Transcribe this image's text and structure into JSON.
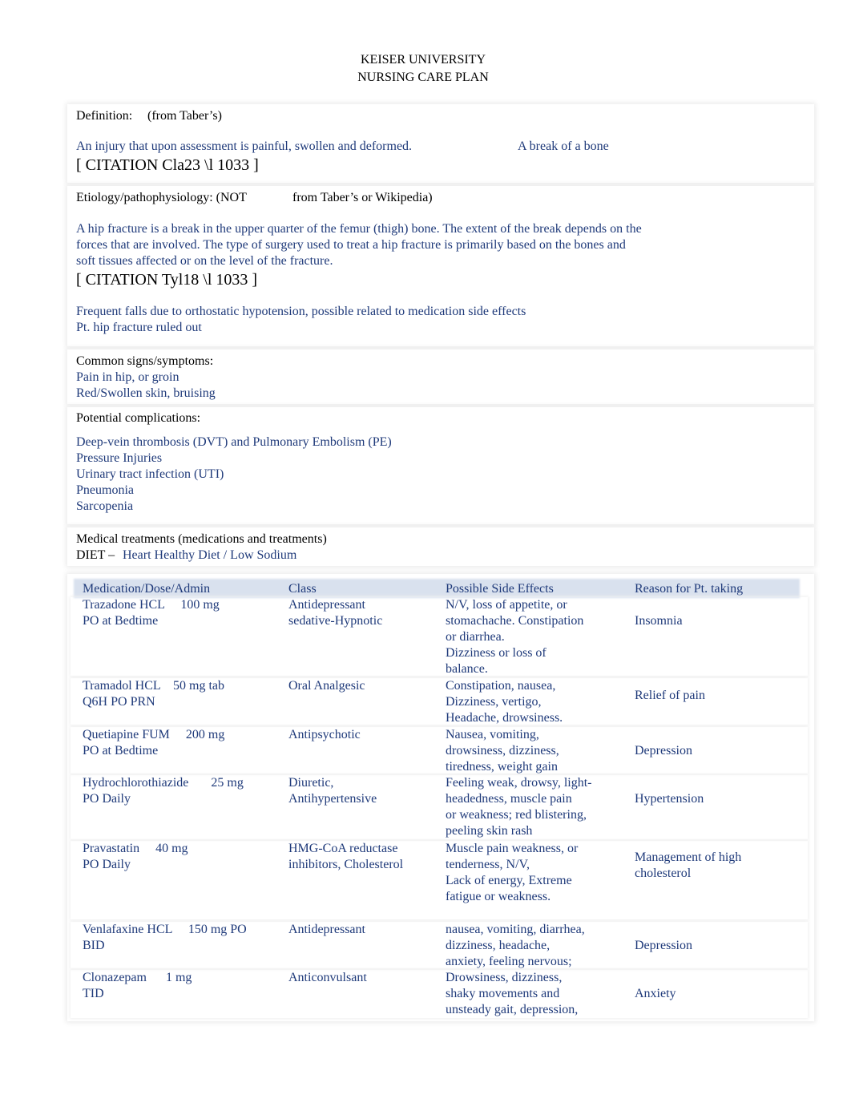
{
  "title": [
    "KEISER UNIVERSITY",
    "NURSING CARE PLAN"
  ],
  "definition": {
    "label": "Definition:",
    "source": "(from Taber’s)",
    "text": "An injury that upon assessment is painful, swollen and deformed.",
    "text2": "A break of a bone",
    "citation": "[ CITATION Cla23 \\l 1033 ]"
  },
  "etiology": {
    "label": "Etiology/pathophysiology: (NOT",
    "label2": "from Taber’s or Wikipedia)",
    "lines": [
      "A hip fracture is a break in the upper quarter of the femur (thigh) bone. The extent of the break depends on the",
      "forces that are involved. The type of surgery used to treat a hip fracture is primarily based on the bones and",
      "soft tissues affected or on the level of the fracture."
    ],
    "citation": "[ CITATION Tyl18 \\l 1033 ]",
    "notes": [
      "Frequent falls due to orthostatic hypotension, possible related to medication side effects",
      "Pt. hip fracture ruled out"
    ]
  },
  "signs": {
    "label": "Common signs/symptoms:",
    "items": [
      "Pain in hip, or groin",
      "Red/Swollen skin, bruising"
    ]
  },
  "complications": {
    "label": "Potential complications:",
    "items": [
      "Deep-vein thrombosis (DVT) and Pulmonary Embolism (PE)",
      "Pressure Injuries",
      "Urinary tract infection (UTI)",
      "Pneumonia",
      "Sarcopenia"
    ]
  },
  "treatments": {
    "label": "Medical treatments (medications and treatments)",
    "diet_label": "DIET – ",
    "diet": "Heart Healthy Diet / Low Sodium"
  },
  "table": {
    "headers": [
      "Medication/Dose/Admin",
      "Class",
      "Possible Side Effects",
      "Reason for Pt. taking"
    ],
    "rows": [
      {
        "med": [
          "Trazadone HCL     100 mg",
          "PO at Bedtime"
        ],
        "cls": [
          "Antidepressant",
          "sedative-Hypnotic"
        ],
        "fx": [
          "N/V, loss of appetite, or",
          "stomachache. Constipation",
          "or diarrhea.",
          "Dizziness or loss of",
          "balance."
        ],
        "reason": "Insomnia"
      },
      {
        "med": [
          "Tramadol HCL    50 mg tab",
          "Q6H PO PRN"
        ],
        "cls": [
          "Oral Analgesic"
        ],
        "fx": [
          "Constipation, nausea,",
          "Dizziness, vertigo,",
          "Headache, drowsiness."
        ],
        "reason": "Relief of pain"
      },
      {
        "med": [
          "Quetiapine FUM     200 mg",
          "PO at Bedtime"
        ],
        "cls": [
          "Antipsychotic"
        ],
        "fx": [
          "Nausea, vomiting,",
          "drowsiness, dizziness,",
          "tiredness, weight gain"
        ],
        "reason": "Depression"
      },
      {
        "med": [
          "Hydrochlorothiazide       25 mg",
          "PO Daily"
        ],
        "cls": [
          "Diuretic,",
          "Antihypertensive"
        ],
        "fx": [
          "Feeling weak, drowsy, light-",
          "headedness, muscle pain",
          "or weakness; red blistering,",
          "peeling skin rash"
        ],
        "reason": "Hypertension"
      },
      {
        "med": [
          "Pravastatin     40 mg",
          "PO Daily"
        ],
        "cls": [
          "HMG-CoA reductase",
          "inhibitors, Cholesterol"
        ],
        "fx": [
          "Muscle pain weakness, or",
          "tenderness, N/V,",
          "Lack of energy, Extreme",
          "fatigue or weakness."
        ],
        "reason": "Management of high\ncholesterol"
      },
      {
        "med": [
          "Venlafaxine HCL     150 mg PO",
          "BID"
        ],
        "cls": [
          "Antidepressant"
        ],
        "fx": [
          "nausea, vomiting, diarrhea,",
          "dizziness, headache,",
          "anxiety, feeling nervous;"
        ],
        "reason": "Depression"
      },
      {
        "med": [
          "Clonazepam      1 mg",
          "TID"
        ],
        "cls": [
          "Anticonvulsant"
        ],
        "fx": [
          "Drowsiness, dizziness,",
          "shaky movements and",
          "unsteady gait, depression,"
        ],
        "reason": "Anxiety"
      }
    ]
  }
}
